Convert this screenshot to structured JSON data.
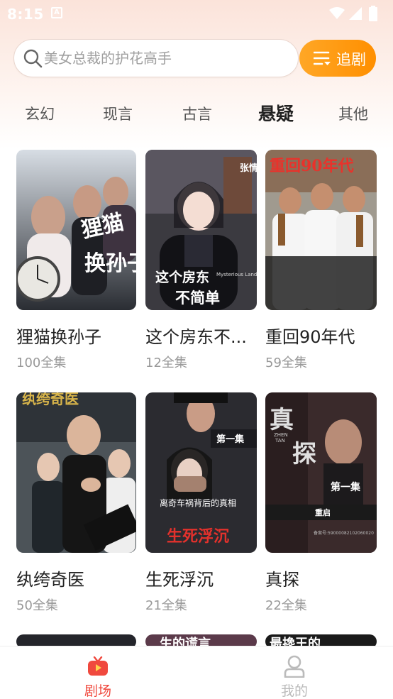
{
  "status_bar": {
    "time": "8:15"
  },
  "search": {
    "placeholder": "美女总裁的护花高手",
    "follow_label": "追剧"
  },
  "tabs": [
    {
      "label": "玄幻"
    },
    {
      "label": "现言"
    },
    {
      "label": "古言"
    },
    {
      "label": "悬疑",
      "active": true
    },
    {
      "label": "其他"
    }
  ],
  "dramas": [
    {
      "title": "狸猫换孙子",
      "count": "100全集",
      "poster_text": [
        "狸猫",
        "换孙子"
      ]
    },
    {
      "title": "这个房东不...",
      "count": "12全集",
      "poster_text": [
        "这个房东",
        "不简单",
        "Mysterious Landlord",
        "张情"
      ]
    },
    {
      "title": "重回90年代",
      "count": "59全集",
      "poster_text": [
        "重回90年代"
      ]
    },
    {
      "title": "纨绔奇医",
      "count": "50全集",
      "poster_text": [
        "纨绔奇医"
      ]
    },
    {
      "title": "生死浮沉",
      "count": "21全集",
      "poster_text": [
        "第一集",
        "离奇车祸背后的真相",
        "生死浮沉"
      ]
    },
    {
      "title": "真探",
      "count": "22全集",
      "poster_text": [
        "真",
        "探",
        "ZHEN",
        "TAN",
        "第一集",
        "重启",
        "备案号:59000082102060020"
      ]
    }
  ],
  "partial_posters": [
    {
      "poster_text": ""
    },
    {
      "poster_text": "生的谎言"
    },
    {
      "poster_text": "最搀王的"
    }
  ],
  "bottom_nav": [
    {
      "label": "剧场",
      "icon": "tv-icon",
      "active": true
    },
    {
      "label": "我的",
      "icon": "user-icon",
      "active": false
    }
  ],
  "colors": {
    "accent": "#ff8f00",
    "nav_active": "#f0493e",
    "nav_inactive": "#bbbbbb"
  }
}
